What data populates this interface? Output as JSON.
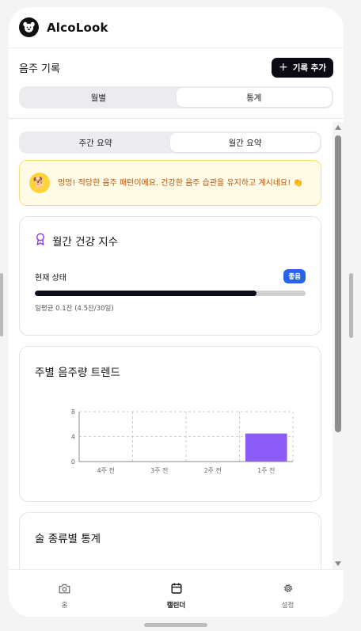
{
  "app": {
    "title": "AlcoLook"
  },
  "section": {
    "title": "음주 기록",
    "add_button": "기록 추가"
  },
  "view_tabs": [
    {
      "label": "월별",
      "active": false
    },
    {
      "label": "통계",
      "active": true
    }
  ],
  "summary_tabs": [
    {
      "label": "주간 요약",
      "active": false
    },
    {
      "label": "월간 요약",
      "active": true
    }
  ],
  "banner": {
    "text": "멍멍! 적당한 음주 패턴이에요. 건강한 음주 습관을 유지하고 계시네요! 👏",
    "icon": "dog-icon"
  },
  "health": {
    "title": "월간 건강 지수",
    "status_label": "현재 상태",
    "status_badge": "좋음",
    "progress": 0.82,
    "note": "일평균 0.1잔 (4.5잔/30일)"
  },
  "trend": {
    "title": "주별 음주량 트렌드"
  },
  "chart_data": {
    "type": "bar",
    "categories": [
      "4주 전",
      "3주 전",
      "2주 전",
      "1주 전"
    ],
    "values": [
      0,
      0,
      0,
      4.5
    ],
    "ylim": [
      0,
      8
    ],
    "yticks": [
      0,
      4,
      8
    ],
    "grid": true,
    "colors": {
      "bar": "#8b5cf6",
      "grid": "#cccccc",
      "axis": "#888888"
    }
  },
  "types": {
    "title": "술 종류별 통계"
  },
  "tabbar": [
    {
      "label": "홈",
      "icon": "camera-icon",
      "active": false
    },
    {
      "label": "캘린더",
      "icon": "calendar-icon",
      "active": true
    },
    {
      "label": "설정",
      "icon": "gear-icon",
      "active": false
    }
  ],
  "colors": {
    "accent": "#0b0b14",
    "badge": "#2563eb",
    "banner_bg": "#fffbe6",
    "banner_text": "#b45309"
  }
}
